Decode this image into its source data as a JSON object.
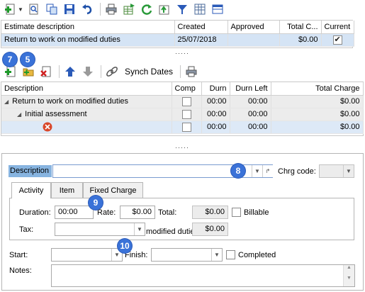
{
  "estimate_grid": {
    "columns": [
      "Estimate description",
      "Created",
      "Approved",
      "Total C...",
      "Current"
    ],
    "rows": [
      {
        "description": "Return to work on modified duties",
        "created": "25/07/2018",
        "approved": "",
        "total": "$0.00",
        "current": true
      }
    ]
  },
  "splitter_dots": "·····",
  "toolbar2": {
    "synch_label": "Synch Dates"
  },
  "badges": {
    "b7": "7",
    "b5": "5",
    "b8": "8",
    "b9": "9",
    "b10": "10"
  },
  "tree_grid": {
    "columns": [
      "Description",
      "Comp",
      "Durn",
      "Durn Left",
      "Total Charge"
    ],
    "rows": [
      {
        "description": "Return to work on modified duties",
        "durn": "00:00",
        "durn_left": "00:00",
        "total": "$0.00"
      },
      {
        "description": "Initial assessment",
        "durn": "00:00",
        "durn_left": "00:00",
        "total": "$0.00"
      },
      {
        "description": "",
        "durn": "00:00",
        "durn_left": "00:00",
        "total": "$0.00"
      }
    ]
  },
  "form": {
    "description_label": "Description",
    "description_value": "",
    "chrg_code_label": "Chrg code:",
    "tabs": [
      "Activity",
      "Item",
      "Fixed Charge"
    ],
    "duration_label": "Duration:",
    "duration_value": "00:00",
    "rate_label": "Rate:",
    "rate_value": "$0.00",
    "total_label": "Total:",
    "total_value": "$0.00",
    "billable_label": "Billable",
    "tax_label": "Tax:",
    "tax_amount": "$0.00",
    "tax_note": "modified duties",
    "start_label": "Start:",
    "finish_label": "Finish:",
    "completed_label": "Completed",
    "notes_label": "Notes:"
  },
  "colors": {
    "selected_row": "#d5e4f5",
    "badge": "#3a72d8",
    "description_highlight": "#87b4e0"
  }
}
